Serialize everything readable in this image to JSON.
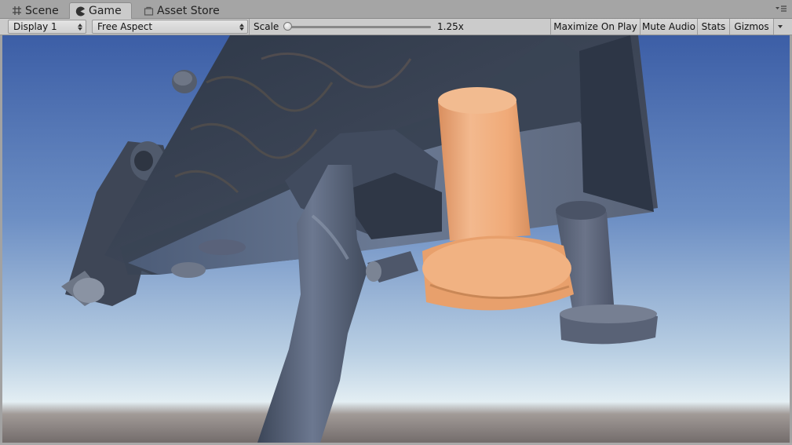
{
  "tabs": [
    {
      "label": "Scene",
      "icon": "scene-grid-icon",
      "active": false
    },
    {
      "label": "Game",
      "icon": "game-pacman-icon",
      "active": true
    },
    {
      "label": "Asset Store",
      "icon": "asset-store-bag-icon",
      "active": false
    }
  ],
  "toolbar": {
    "display": "Display 1",
    "aspect": "Free Aspect",
    "scale_label": "Scale",
    "scale_value": "1.25x",
    "scale_level": 0.0,
    "maximize_on_play": "Maximize On Play",
    "mute_audio": "Mute Audio",
    "stats": "Stats",
    "gizmos": "Gizmos"
  },
  "viewport": {
    "description_icon": "3d-scene-render",
    "colors": {
      "sky_top": "#3f62a6",
      "sky_horizon": "#d9e6ef",
      "ground": "#7d7775",
      "metal_dark": "#3f4a5e",
      "peg_orange": "#e9a678",
      "peg_blue": "#5b6578"
    }
  }
}
